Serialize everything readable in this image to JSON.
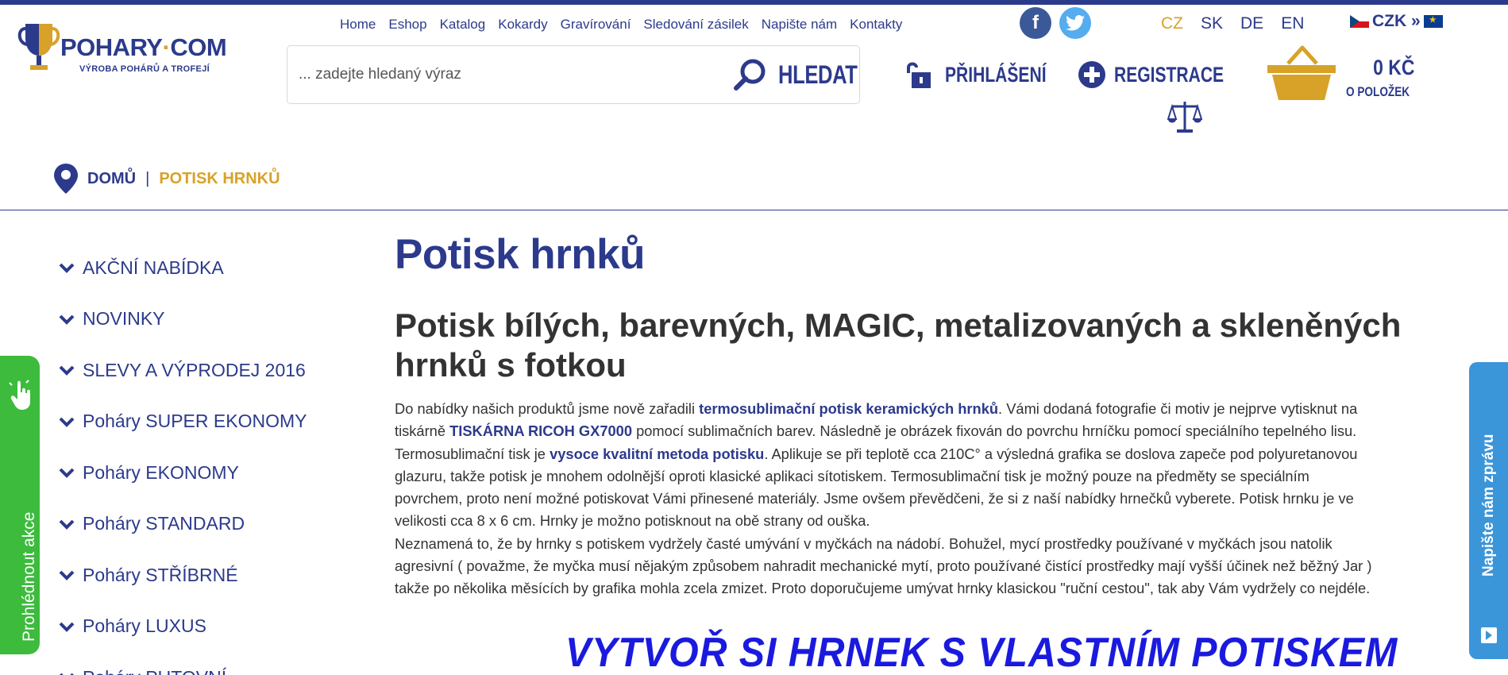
{
  "logo": {
    "name": "POHARY",
    "dot": "·",
    "tld": "COM",
    "tagline": "VÝROBA POHÁRŮ A TROFEJÍ"
  },
  "topnav": [
    "Home",
    "Eshop",
    "Katalog",
    "Kokardy",
    "Gravírování",
    "Sledování zásilek",
    "Napište nám",
    "Kontakty"
  ],
  "social": {
    "facebook": "f",
    "twitter": "🐦"
  },
  "languages": [
    {
      "code": "CZ",
      "active": true
    },
    {
      "code": "SK",
      "active": false
    },
    {
      "code": "DE",
      "active": false
    },
    {
      "code": "EN",
      "active": false
    }
  ],
  "currency": {
    "label": "CZK »"
  },
  "search": {
    "placeholder": "... zadejte hledaný výraz",
    "button": "HLEDAT"
  },
  "account": {
    "login": "PŘIHLÁŠENÍ",
    "register": "REGISTRACE"
  },
  "cart": {
    "total": "0 KČ",
    "items": "O POLOŽEK"
  },
  "breadcrumb": {
    "home": "DOMŮ",
    "separator": "|",
    "current": "POTISK HRNKŮ"
  },
  "sidebar": [
    "AKČNÍ NABÍDKA",
    "NOVINKY",
    "SLEVY A VÝPRODEJ 2016",
    "Poháry SUPER EKONOMY",
    "Poháry EKONOMY",
    "Poháry STANDARD",
    "Poháry STŘÍBRNÉ",
    "Poháry LUXUS",
    "Poháry PUTOVNÍ"
  ],
  "promo_tab": "Prohlédnout akce",
  "message_tab": "Napište nám zprávu",
  "main": {
    "title": "Potisk hrnků",
    "subtitle": "Potisk bílých, barevných, MAGIC, metalizovaných a skleněných hrnků s fotkou",
    "lines": [
      [
        "Do nabídky našich produktů jsme nově zařadili ",
        "termosublimační potisk keramických hrnků",
        ". Vámi dodaná fotografie či motiv je nejprve vytisknut na"
      ],
      [
        "tiskárně ",
        "TISKÁRNA RICOH GX7000",
        " pomocí sublimačních barev. Následně je obrázek fixován do povrchu hrníčku pomocí speciálního tepelného lisu."
      ],
      [
        "Termosublimační tisk je ",
        "vysoce kvalitní metoda potisku",
        ". Aplikuje se při teplotě cca 210C° a výsledná grafika se doslova zapeče pod polyuretanovou"
      ],
      [
        "glazuru, takže potisk je mnohem odolnější oproti klasické aplikaci sítotiskem. Termosublimační tisk je možný pouze na předměty se speciálním",
        "",
        ""
      ],
      [
        "povrchem, proto není možné potiskovat Vámi přinesené materiály. Jsme ovšem převědčeni, že si z naší nabídky hrnečků vyberete. Potisk hrnku je ve",
        "",
        ""
      ],
      [
        "velikosti cca 8 x 6 cm. Hrnky je možno potisknout na obě strany od ouška.",
        "",
        ""
      ],
      [
        "Neznamená to,  že by hrnky s potiskem vydržely časté umývání v myčkách na nádobí. Bohužel, mycí prostředky používané v myčkách jsou natolik",
        "",
        ""
      ],
      [
        "agresivní ( považme, že myčka musí nějakým způsobem nahradit mechanické mytí, proto používané čistící prostředky mají vyšší účinek než běžný Jar )",
        "",
        ""
      ],
      [
        "takže po několika měsících by grafika mohla zcela zmizet. Proto doporučujeme umývat hrnky klasickou \"ruční cestou\", tak aby Vám vydržely co nejdéle.",
        "",
        ""
      ]
    ],
    "banner": "VYTVOŘ SI HRNEK S VLASTNÍM POTISKEM"
  },
  "colors": {
    "brand": "#2c3a8c",
    "accent": "#d8a229",
    "green": "#3dbb3d",
    "blue": "#3b95d9",
    "banner": "#1a1adf"
  }
}
